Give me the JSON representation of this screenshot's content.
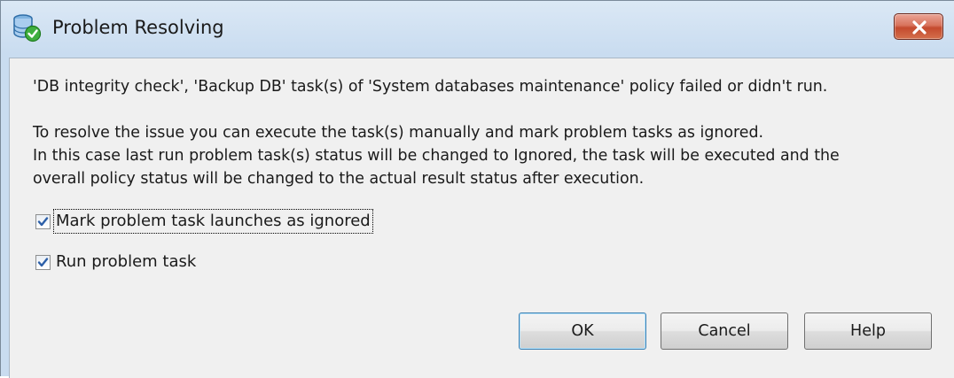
{
  "dialog": {
    "title": "Problem Resolving",
    "icon": "database-check-icon"
  },
  "message": {
    "line1": "'DB integrity check', 'Backup DB' task(s) of 'System databases maintenance' policy failed or didn't run.",
    "line2": "To resolve the issue you can execute the task(s) manually and mark problem tasks as ignored.",
    "line3": "In this case last run problem task(s) status will be changed to Ignored, the task will be executed and the",
    "line4": "overall policy status will be changed to the actual result status after execution."
  },
  "options": [
    {
      "label": "Mark problem task launches as ignored",
      "checked": true,
      "focused": true
    },
    {
      "label": "Run problem task",
      "checked": true,
      "focused": false
    }
  ],
  "buttons": {
    "ok": "OK",
    "cancel": "Cancel",
    "help": "Help"
  },
  "colors": {
    "title_bar": "#c9dcf0",
    "close_button": "#c44a2e",
    "client_area": "#f0f0f0",
    "check_mark": "#2c5fa8"
  }
}
